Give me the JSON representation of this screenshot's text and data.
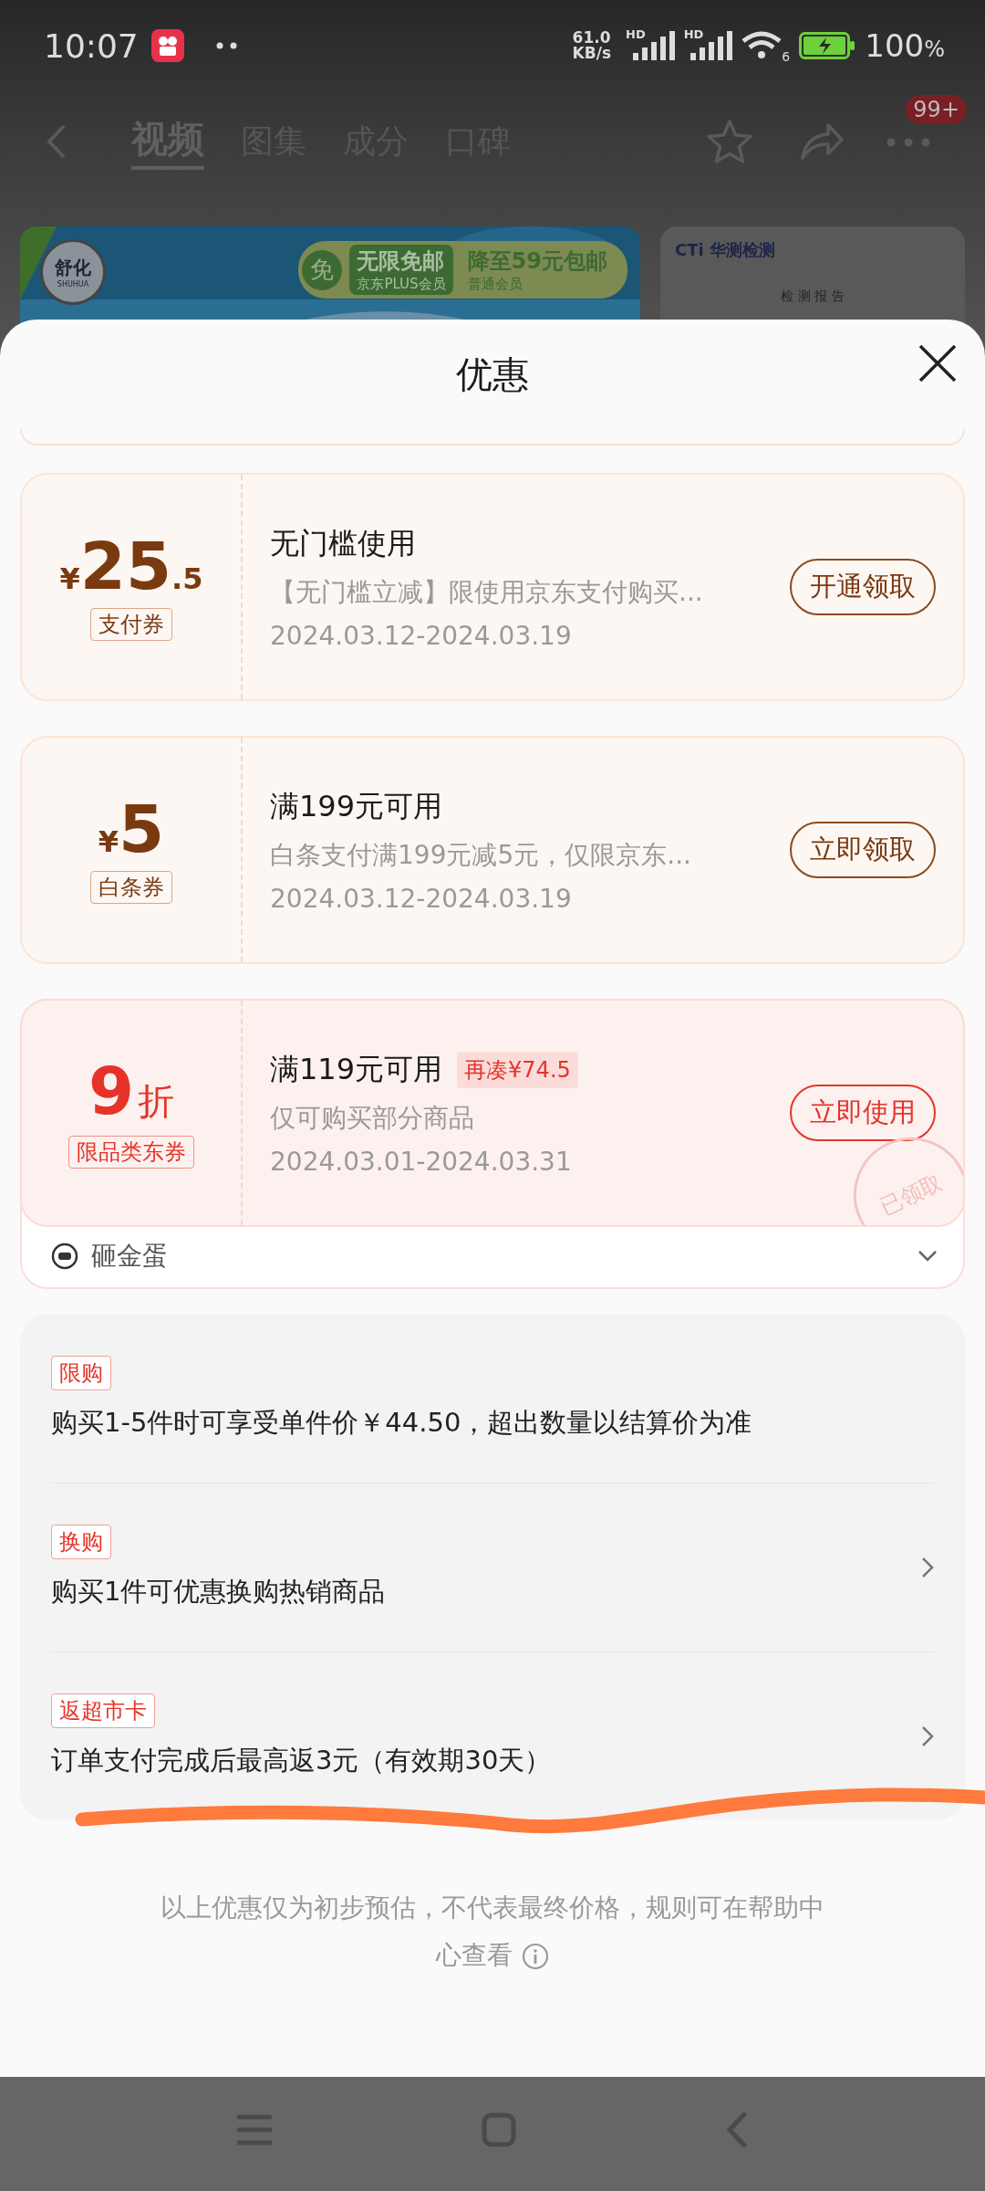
{
  "status_bar": {
    "time": "10:07",
    "net_speed": "61.0",
    "net_unit": "KB/s",
    "sim_labels": [
      "HD",
      "HD"
    ],
    "wifi_label": "6",
    "battery": "100",
    "battery_unit": "%"
  },
  "nav": {
    "tabs": [
      {
        "label": "视频",
        "selected": true
      },
      {
        "label": "图集",
        "selected": false
      },
      {
        "label": "成分",
        "selected": false
      },
      {
        "label": "口碑",
        "selected": false
      }
    ],
    "badge": "99+"
  },
  "background": {
    "banner": {
      "logo": "舒化",
      "logo_sub": "SHUHUA",
      "free_badge": "免",
      "free_title": "无限免邮",
      "plus": "京东PLUS会员",
      "reduce": "降至59元包邮",
      "regular": "普通会员"
    },
    "report": {
      "brand": "CTi 华测检测",
      "title": "检 测 报 告"
    }
  },
  "sheet": {
    "title": "优惠",
    "coupons": [
      {
        "kind": "cash",
        "prefix": "¥",
        "amount": "25",
        "suffix": ".5",
        "tag": "支付券",
        "title": "无门槛使用",
        "desc": "【无门槛立减】限使用京东支付购买...",
        "dates": "2024.03.12-2024.03.19",
        "button": "开通领取"
      },
      {
        "kind": "cash",
        "prefix": "¥",
        "amount": "5",
        "tag": "白条券",
        "title": "满199元可用",
        "desc": "白条支付满199元减5元，仅限京东...",
        "dates": "2024.03.12-2024.03.19",
        "button": "立即领取"
      },
      {
        "kind": "discount",
        "amount": "9",
        "suffix": "折",
        "tag": "限品类东券",
        "title": "满119元可用",
        "extra": "再凑¥74.5",
        "desc": "仅可购买部分商品",
        "dates": "2024.03.01-2024.03.31",
        "button": "立即使用",
        "stamp": "已领取"
      }
    ],
    "egg": {
      "label": "砸金蛋",
      "expanded": false
    },
    "info": [
      {
        "tag": "限购",
        "text": "购买1-5件时可享受单件价￥44.50，超出数量以结算价为准",
        "arrow": false
      },
      {
        "tag": "换购",
        "text": "购买1件可优惠换购热销商品",
        "arrow": true
      },
      {
        "tag": "返超市卡",
        "text": "订单支付完成后最高返3元（有效期30天）",
        "arrow": true
      }
    ],
    "note": "以上优惠仅为初步预估，不代表最终价格，规则可在帮助中心查看"
  }
}
